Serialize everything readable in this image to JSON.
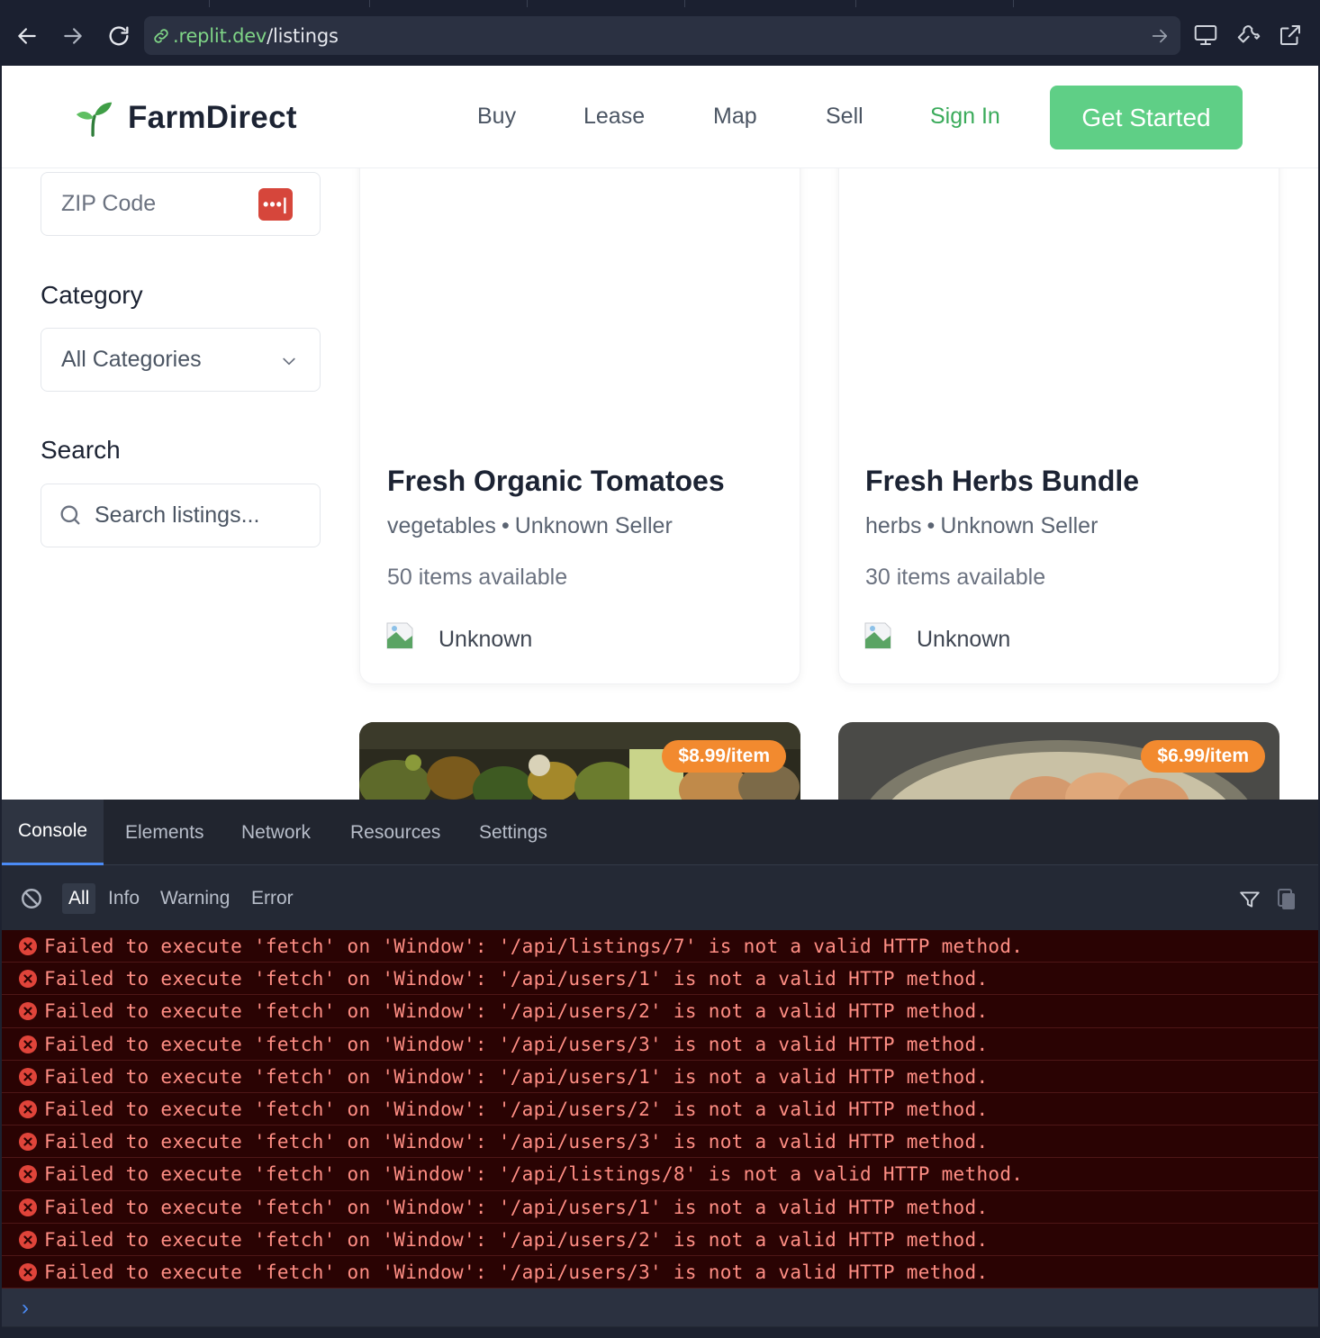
{
  "browser": {
    "url_host": ".replit.dev",
    "url_path": "/listings"
  },
  "header": {
    "brand": "FarmDirect",
    "nav": [
      "Buy",
      "Lease",
      "Map",
      "Sell"
    ],
    "sign_in": "Sign In",
    "get_started": "Get Started"
  },
  "sidebar": {
    "zip_placeholder": "ZIP Code",
    "zip_badge": "•••|",
    "category_label": "Category",
    "category_value": "All Categories",
    "search_label": "Search",
    "search_placeholder": "Search listings..."
  },
  "listings": [
    {
      "title": "Fresh Organic Tomatoes",
      "category": "vegetables",
      "seller_label": "Unknown Seller",
      "availability": "50 items available",
      "seller_name": "Unknown"
    },
    {
      "title": "Fresh Herbs Bundle",
      "category": "herbs",
      "seller_label": "Unknown Seller",
      "availability": "30 items available",
      "seller_name": "Unknown"
    }
  ],
  "next_listings": [
    {
      "price": "$8.99/item"
    },
    {
      "price": "$6.99/item"
    }
  ],
  "devtools": {
    "tabs": [
      "Console",
      "Elements",
      "Network",
      "Resources",
      "Settings"
    ],
    "active_tab": "Console",
    "filters": [
      "All",
      "Info",
      "Warning",
      "Error"
    ],
    "active_filter": "All",
    "logs": [
      "Failed to execute 'fetch' on 'Window': '/api/listings/7' is not a valid HTTP method.",
      "Failed to execute 'fetch' on 'Window': '/api/users/1' is not a valid HTTP method.",
      "Failed to execute 'fetch' on 'Window': '/api/users/2' is not a valid HTTP method.",
      "Failed to execute 'fetch' on 'Window': '/api/users/3' is not a valid HTTP method.",
      "Failed to execute 'fetch' on 'Window': '/api/users/1' is not a valid HTTP method.",
      "Failed to execute 'fetch' on 'Window': '/api/users/2' is not a valid HTTP method.",
      "Failed to execute 'fetch' on 'Window': '/api/users/3' is not a valid HTTP method.",
      "Failed to execute 'fetch' on 'Window': '/api/listings/8' is not a valid HTTP method.",
      "Failed to execute 'fetch' on 'Window': '/api/users/1' is not a valid HTTP method.",
      "Failed to execute 'fetch' on 'Window': '/api/users/2' is not a valid HTTP method.",
      "Failed to execute 'fetch' on 'Window': '/api/users/3' is not a valid HTTP method."
    ],
    "prompt_symbol": "›"
  },
  "icons": {
    "back": "arrow-left-icon",
    "forward": "arrow-right-icon",
    "reload": "reload-icon",
    "link": "link-icon",
    "go": "arrow-right-icon",
    "devices": "monitor-icon",
    "tools": "wrench-icon",
    "external": "external-link-icon",
    "logo": "sprout-icon",
    "chevron": "chevron-down-icon",
    "search": "search-icon",
    "clear": "clear-console-icon",
    "filter": "filter-icon",
    "copy": "copy-icon",
    "error": "error-circle-icon"
  },
  "colors": {
    "brand_green": "#5fcf86",
    "sign_in_green": "#3bab5b",
    "price_orange": "#f28a2f",
    "error_text": "#ff8e84",
    "error_bg": "#2a0303",
    "accent_blue": "#4b8bf5"
  }
}
